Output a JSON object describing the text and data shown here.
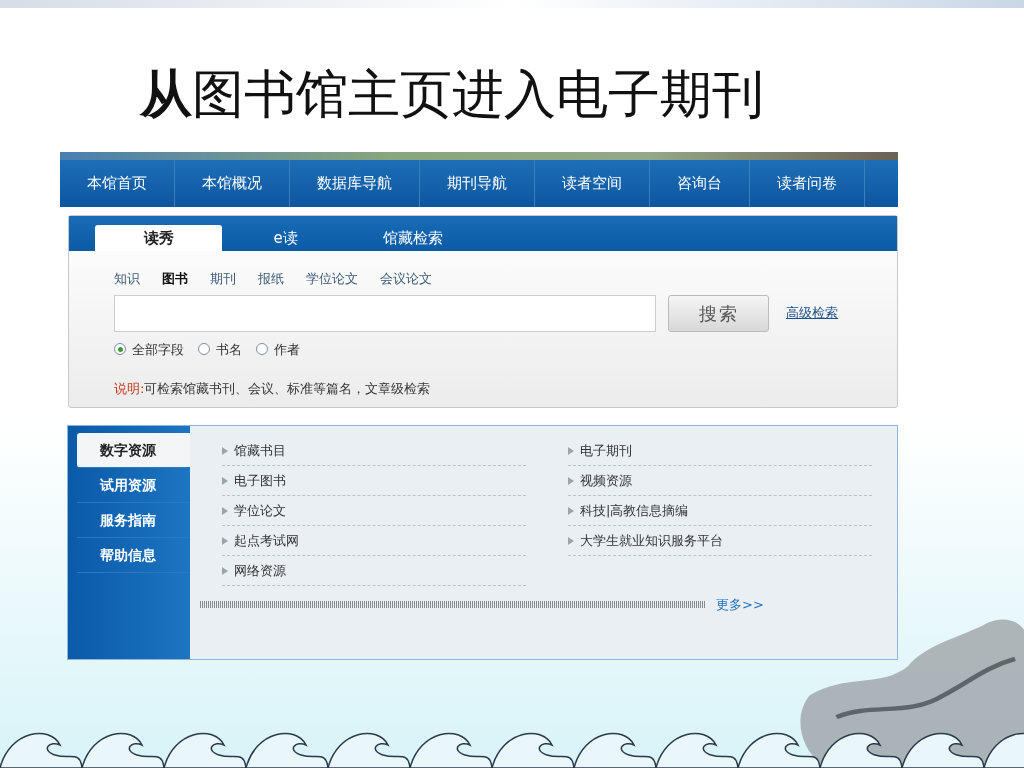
{
  "slide_title": "**从**图书馆主页进入电子期刊",
  "nav": {
    "items": [
      {
        "label": "本馆首页"
      },
      {
        "label": "本馆概况"
      },
      {
        "label": "数据库导航"
      },
      {
        "label": "期刊导航"
      },
      {
        "label": "读者空间"
      },
      {
        "label": "咨询台"
      },
      {
        "label": "读者问卷"
      }
    ]
  },
  "search": {
    "tabs": [
      {
        "label": "读秀",
        "selected": true
      },
      {
        "label": "e读",
        "selected": false
      },
      {
        "label": "馆藏检索",
        "selected": false
      }
    ],
    "categories": [
      {
        "label": "知识",
        "selected": false
      },
      {
        "label": "图书",
        "selected": true
      },
      {
        "label": "期刊",
        "selected": false
      },
      {
        "label": "报纸",
        "selected": false
      },
      {
        "label": "学位论文",
        "selected": false
      },
      {
        "label": "会议论文",
        "selected": false
      }
    ],
    "button": "搜索",
    "advanced_link": "高级检索",
    "fields": [
      {
        "label": "全部字段",
        "selected": true
      },
      {
        "label": "书名",
        "selected": false
      },
      {
        "label": "作者",
        "selected": false
      }
    ],
    "note_label": "说明:",
    "note_text": "可检索馆藏书刊、会议、标准等篇名，文章级检索"
  },
  "resources": {
    "side_tabs": [
      {
        "label": "数字资源",
        "selected": true
      },
      {
        "label": "试用资源",
        "selected": false
      },
      {
        "label": "服务指南",
        "selected": false
      },
      {
        "label": "帮助信息",
        "selected": false
      }
    ],
    "left_links": [
      "馆藏书目",
      "电子图书",
      "学位论文",
      "起点考试网",
      "网络资源"
    ],
    "right_links": [
      "电子期刊",
      "视频资源",
      "科技|高教信息摘编",
      "大学生就业知识服务平台"
    ],
    "more_link": "更多>>"
  }
}
